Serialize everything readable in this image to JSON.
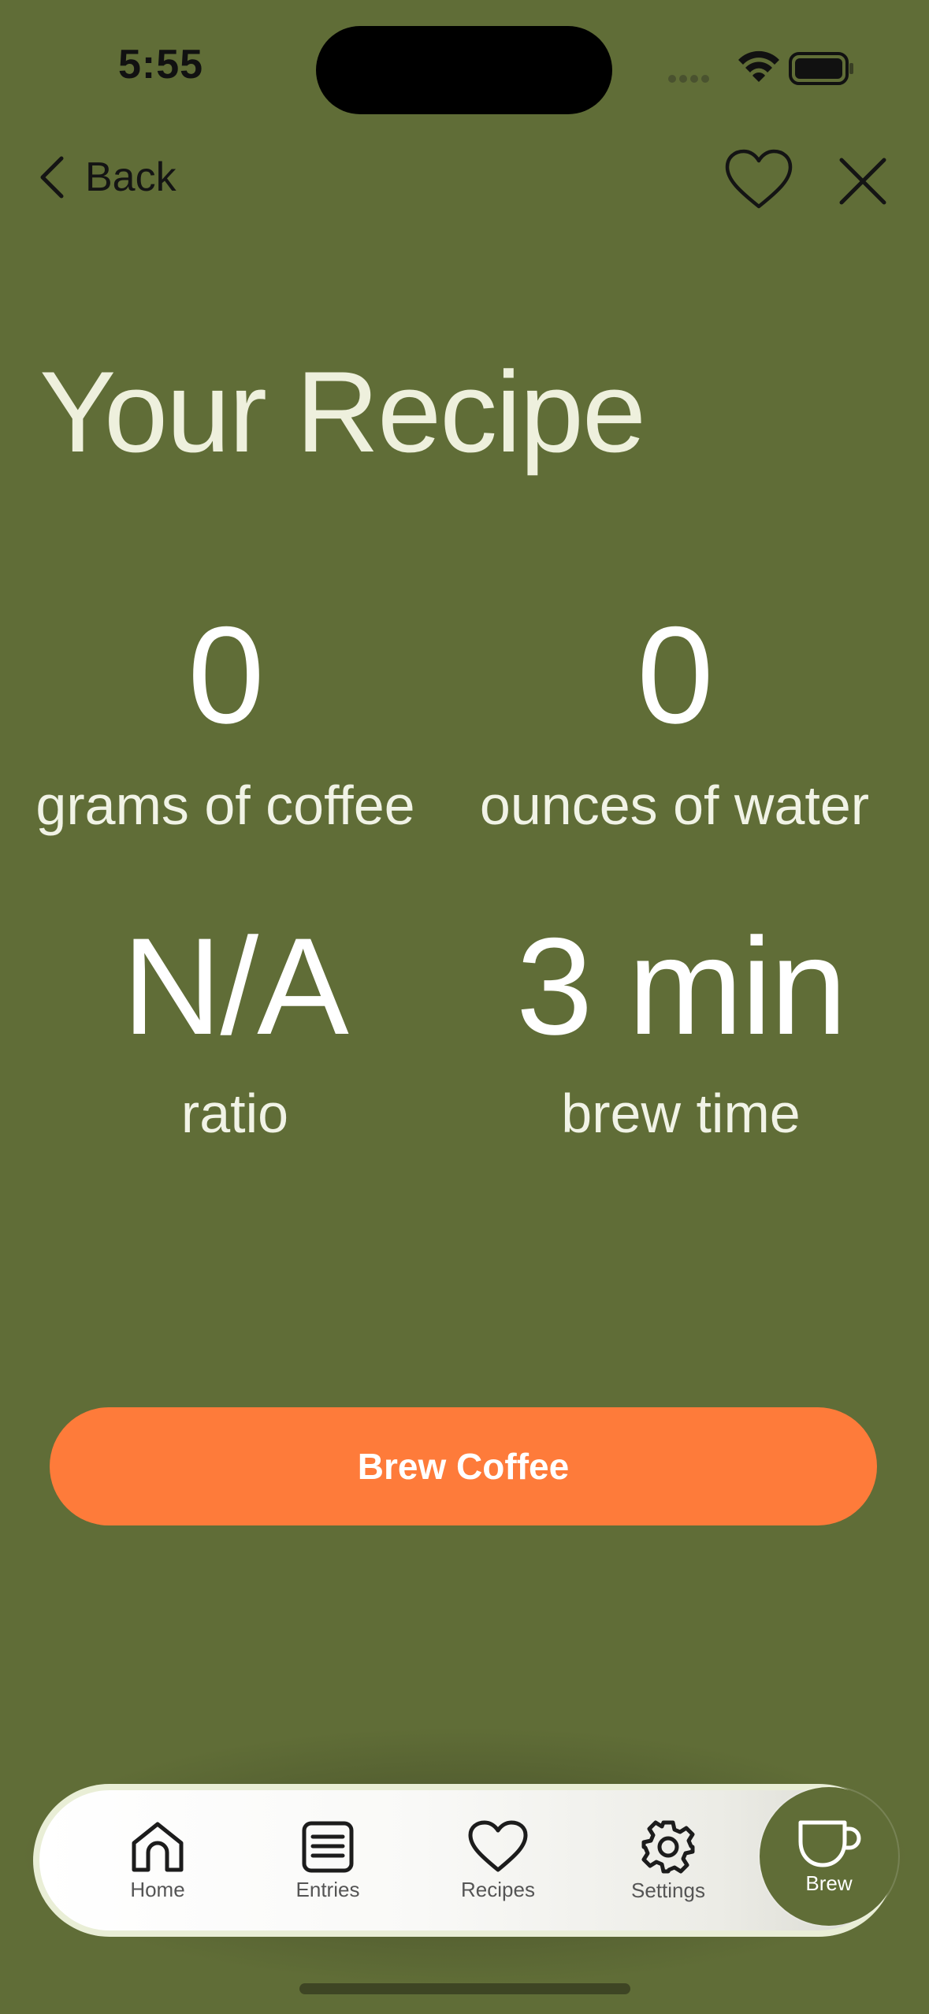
{
  "status_bar": {
    "time": "5:55"
  },
  "nav": {
    "back_label": "Back",
    "back_icon": "chevron-left-icon",
    "favorite_icon": "heart-outline-icon",
    "close_icon": "close-x-icon"
  },
  "title": "Your Recipe",
  "stats": {
    "coffee": {
      "value": "0",
      "caption": "grams of coffee"
    },
    "water": {
      "value": "0",
      "caption": "ounces of water"
    },
    "ratio": {
      "value": "N/A",
      "caption": "ratio"
    },
    "brew_time": {
      "value": "3 min",
      "caption": "brew time"
    }
  },
  "brew_button_label": "Brew Coffee",
  "tab_bar": {
    "items": [
      {
        "label": "Home",
        "icon": "house-icon"
      },
      {
        "label": "Entries",
        "icon": "list-document-icon"
      },
      {
        "label": "Recipes",
        "icon": "heart-icon"
      },
      {
        "label": "Settings",
        "icon": "gear-icon"
      },
      {
        "label": "Brew",
        "icon": "coffee-cup-icon",
        "active": true
      }
    ]
  },
  "colors": {
    "background": "#606d37",
    "title_text": "#eef0dd",
    "accent_button": "#fe7b3a",
    "tab_bar_border": "#e9eed6",
    "active_tab": "#606d37"
  }
}
